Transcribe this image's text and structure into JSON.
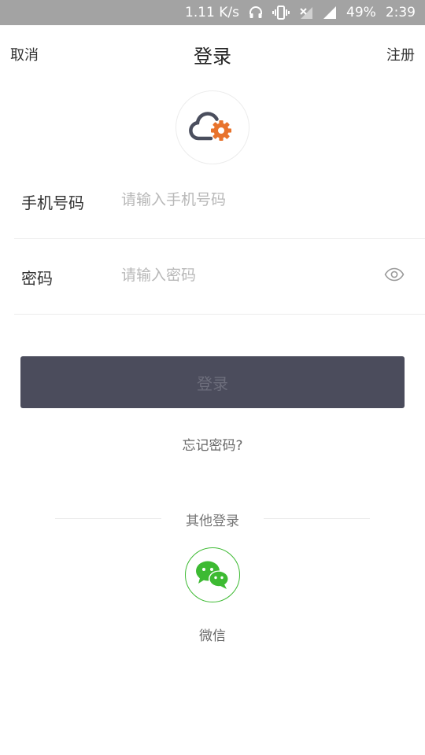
{
  "status_bar": {
    "speed": "1.11 K/s",
    "battery": "49%",
    "time": "2:39",
    "icons": [
      "headphones-icon",
      "vibrate-icon",
      "mobile-data-off-icon",
      "signal-icon"
    ]
  },
  "header": {
    "cancel_label": "取消",
    "title": "登录",
    "register_label": "注册"
  },
  "logo": {
    "icon": "cloud-gear-logo-icon",
    "colors": {
      "cloud": "#4a4e5d",
      "gear": "#e8732c"
    }
  },
  "form": {
    "phone": {
      "label": "手机号码",
      "value": "",
      "placeholder": "请输入手机号码"
    },
    "password": {
      "label": "密码",
      "value": "",
      "placeholder": "请输入密码",
      "toggle_icon": "eye-icon"
    }
  },
  "login_button": {
    "label": "登录",
    "colors": {
      "background": "#4b4c5c",
      "text": "#6d6e7c"
    }
  },
  "forgot_password_label": "忘记密码?",
  "other_login": {
    "title": "其他登录",
    "providers": [
      {
        "icon": "wechat-icon",
        "label": "微信",
        "color": "#3dba32"
      }
    ]
  }
}
